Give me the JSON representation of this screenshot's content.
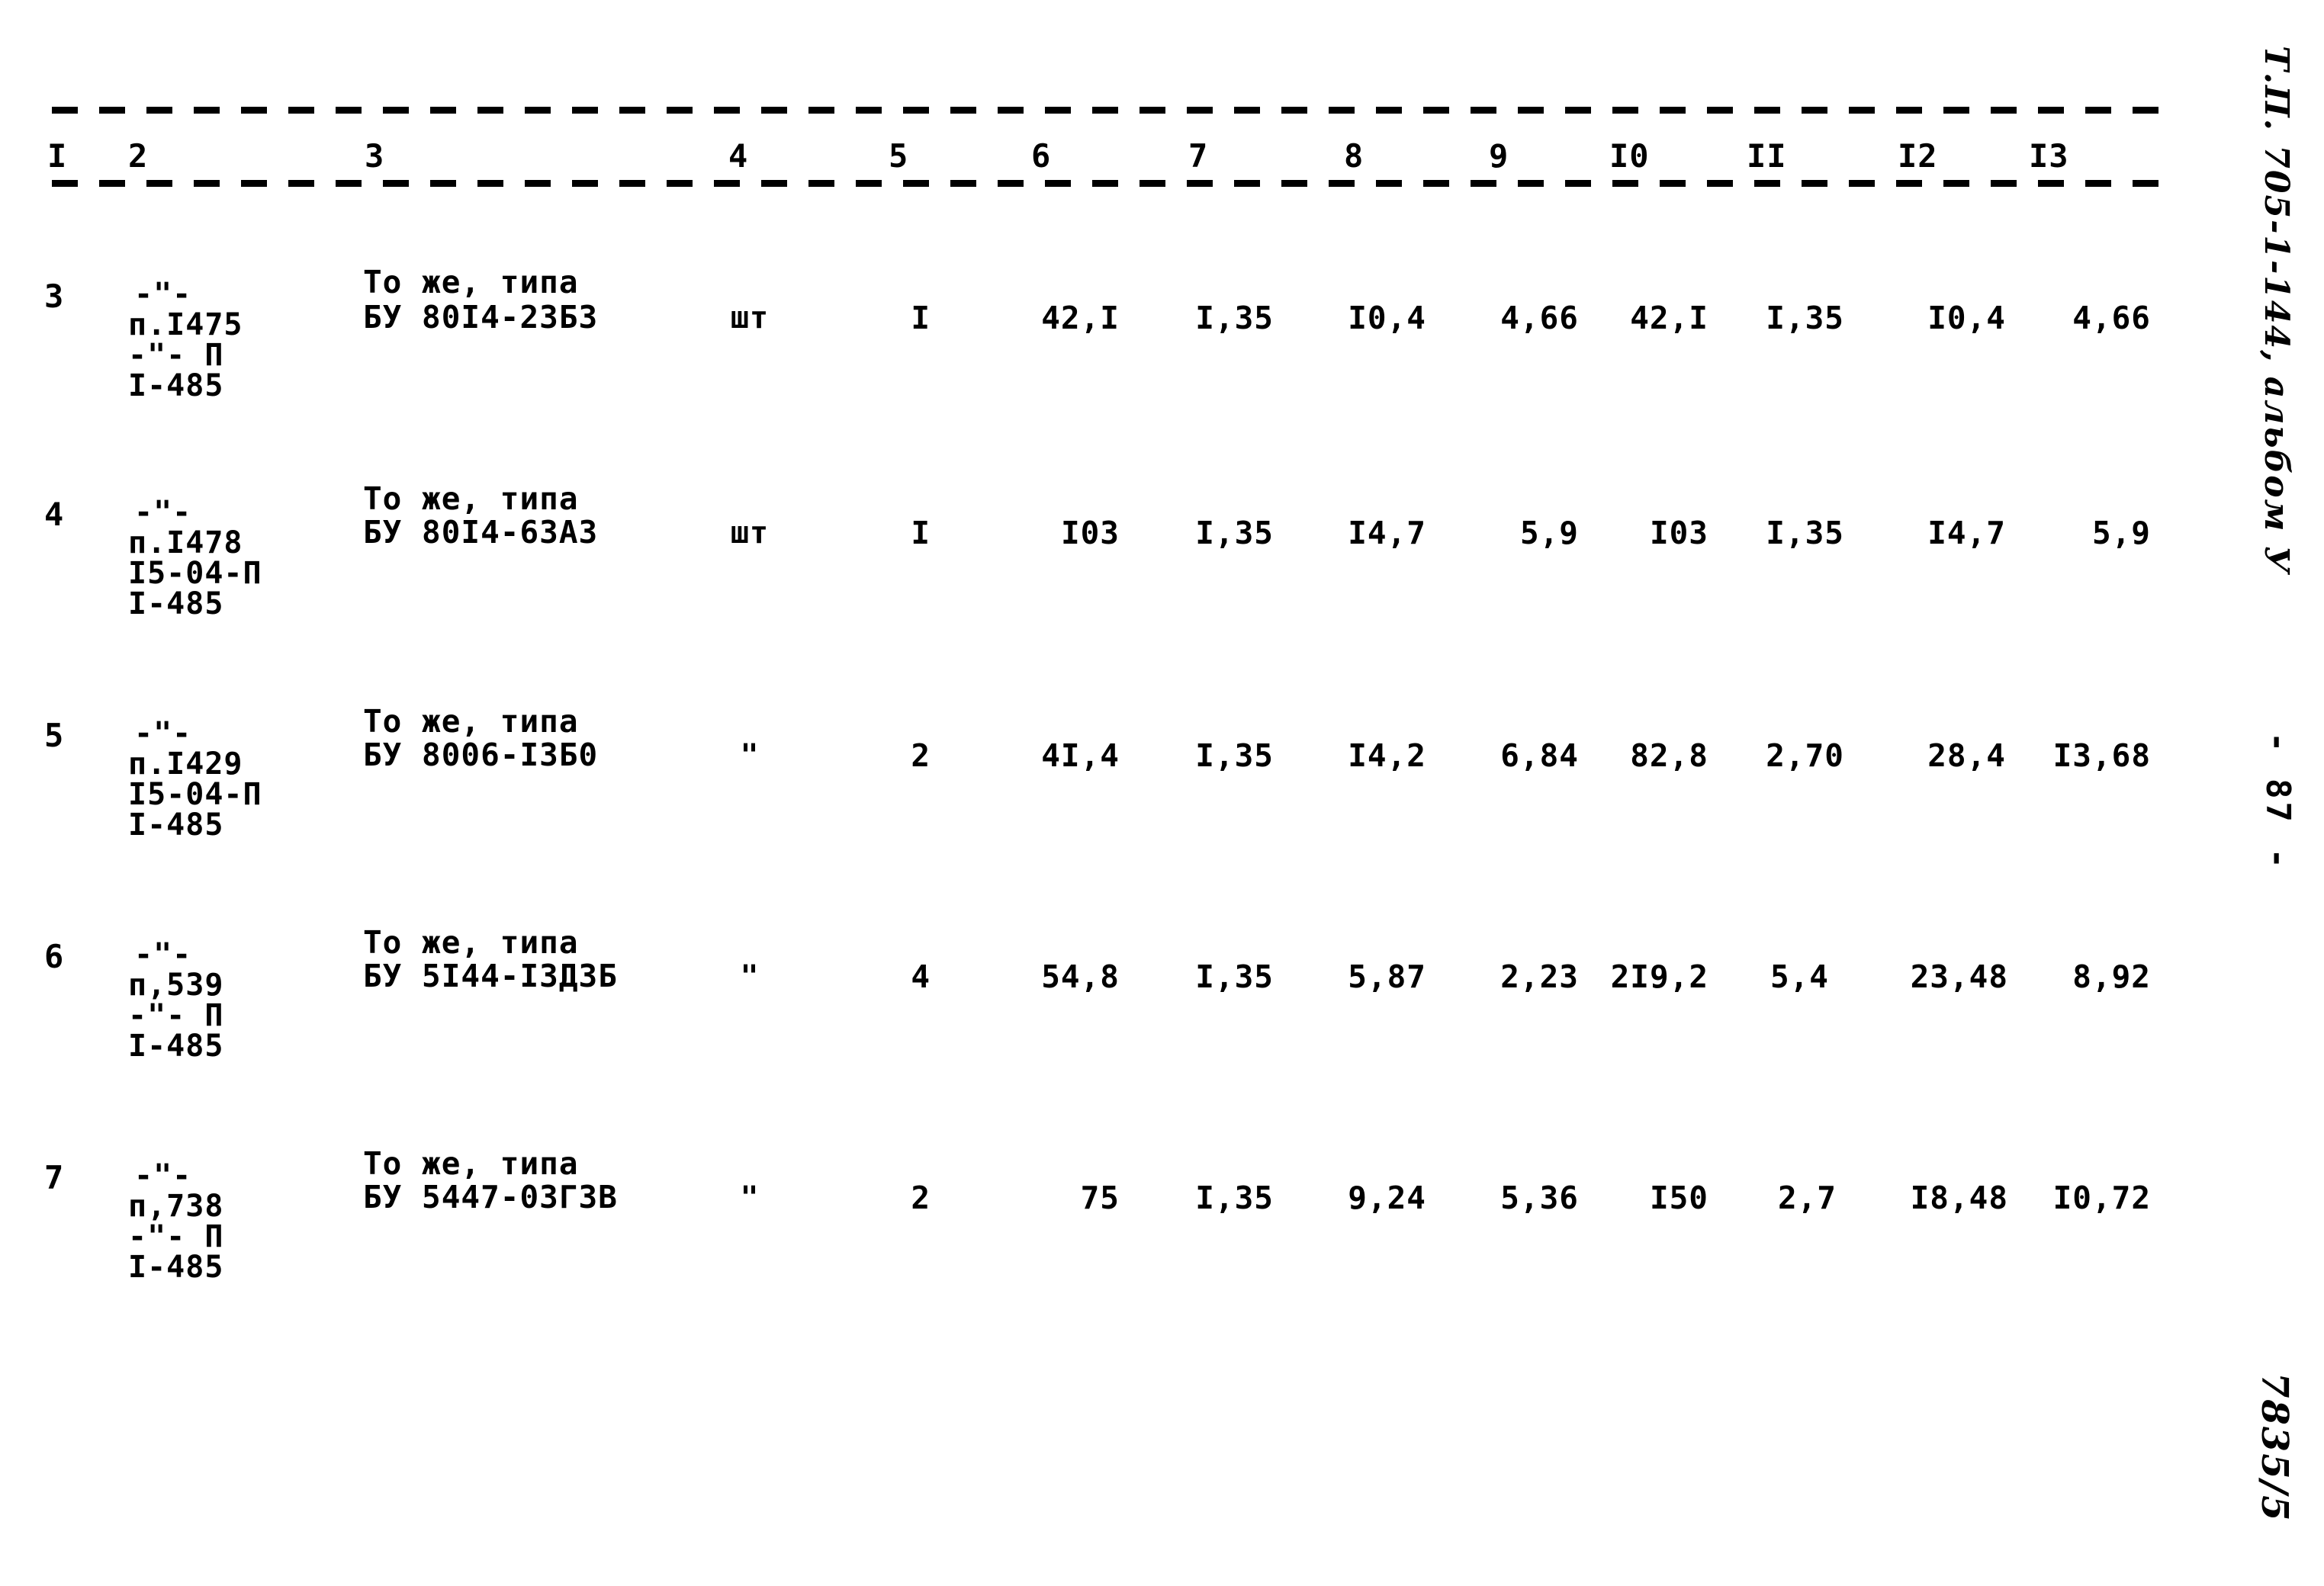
{
  "document": {
    "stamp_top": "Т.П. 705-1-144, альбом У",
    "page_number": "- 87 -",
    "doc_code": "7835/5"
  },
  "table": {
    "column_headers": [
      "I",
      "2",
      "3",
      "4",
      "5",
      "6",
      "7",
      "8",
      "9",
      "I0",
      "II",
      "I2",
      "I3"
    ],
    "rows": [
      {
        "num": "3",
        "ref_lines": [
          "-\"-",
          "п.I475",
          "-\"- П",
          "I-485"
        ],
        "name_lines": [
          "То же, типа",
          "БУ 80I4-23Б3"
        ],
        "unit": "шт",
        "qty": "I",
        "c6": "42,I",
        "c7": "I,35",
        "c8": "I0,4",
        "c9": "4,66",
        "c10": "42,I",
        "c11": "I,35",
        "c12": "I0,4",
        "c13": "4,66"
      },
      {
        "num": "4",
        "ref_lines": [
          "-\"-",
          "п.I478",
          "I5-04-П",
          "I-485"
        ],
        "name_lines": [
          "То же, типа",
          "БУ 80I4-63А3"
        ],
        "unit": "шт",
        "qty": "I",
        "c6": "I03",
        "c7": "I,35",
        "c8": "I4,7",
        "c9": "5,9",
        "c10": "I03",
        "c11": "I,35",
        "c12": "I4,7",
        "c13": "5,9"
      },
      {
        "num": "5",
        "ref_lines": [
          "-\"-",
          "п.I429",
          "I5-04-П",
          "I-485"
        ],
        "name_lines": [
          "То же, типа",
          "БУ 8006-I3Б0"
        ],
        "unit": "\"",
        "qty": "2",
        "c6": "4I,4",
        "c7": "I,35",
        "c8": "I4,2",
        "c9": "6,84",
        "c10": "82,8",
        "c11": "2,70",
        "c12": "28,4",
        "c13": "I3,68"
      },
      {
        "num": "6",
        "ref_lines": [
          "-\"-",
          "п,539",
          "-\"- П",
          "I-485"
        ],
        "name_lines": [
          "То же, типа",
          "БУ 5I44-I3Д3Б"
        ],
        "unit": "\"",
        "qty": "4",
        "c6": "54,8",
        "c7": "I,35",
        "c8": "5,87",
        "c9": "2,23",
        "c10": "2I9,2",
        "c11": "5,4",
        "c12": "23,48",
        "c13": "8,92"
      },
      {
        "num": "7",
        "ref_lines": [
          "-\"-",
          "п,738",
          "-\"- П",
          "I-485"
        ],
        "name_lines": [
          "То же, типа",
          "БУ 5447-03Г3В"
        ],
        "unit": "\"",
        "qty": "2",
        "c6": "75",
        "c7": "I,35",
        "c8": "9,24",
        "c9": "5,36",
        "c10": "I50",
        "c11": "2,7",
        "c12": "I8,48",
        "c13": "I0,72"
      }
    ]
  }
}
